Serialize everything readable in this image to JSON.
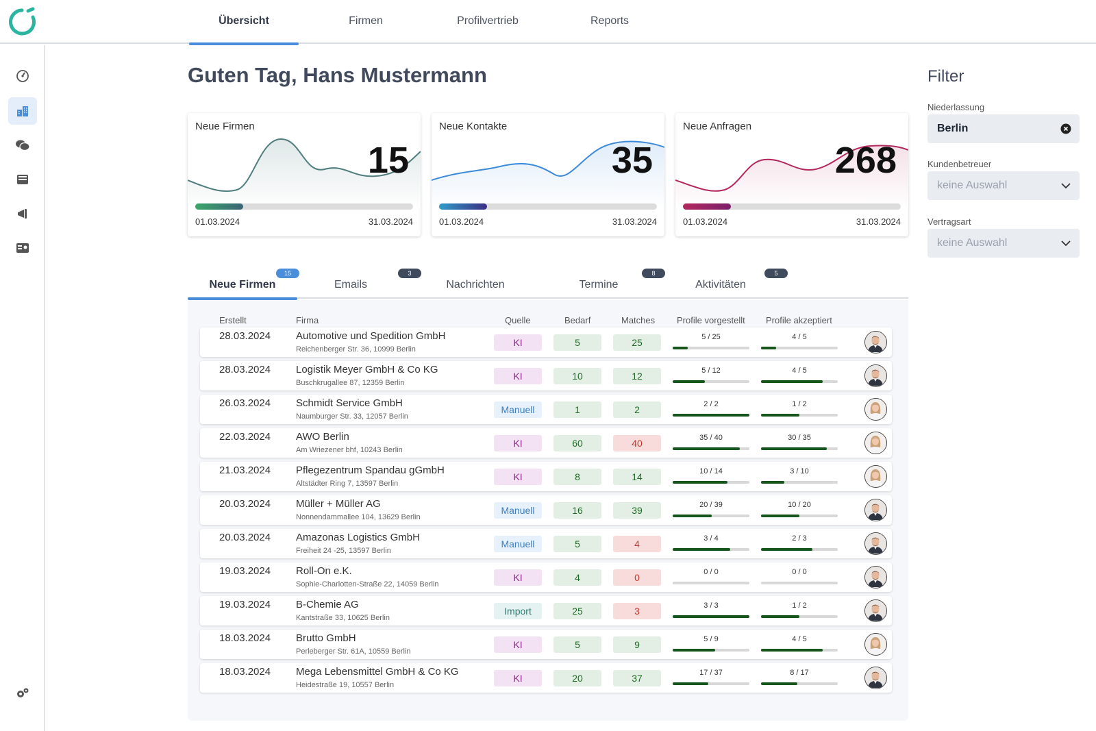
{
  "nav": {
    "tabs": [
      {
        "label": "Übersicht",
        "active": true
      },
      {
        "label": "Firmen",
        "active": false
      },
      {
        "label": "Profilvertrieb",
        "active": false
      },
      {
        "label": "Reports",
        "active": false
      }
    ]
  },
  "sidebar": {
    "icons": [
      "dashboard-gauge-icon",
      "buildings-icon",
      "chat-bubbles-icon",
      "inbox-tray-icon",
      "megaphone-icon",
      "id-card-icon",
      "settings-gears-icon"
    ],
    "active": "buildings-icon"
  },
  "greeting": "Guten Tag, Hans Mustermann",
  "stats": [
    {
      "title": "Neue Firmen",
      "value": "15",
      "start": "01.03.2024",
      "end": "31.03.2024",
      "progress": 0.22,
      "color": "#4f7d7e",
      "gradient": [
        "#3aa86a",
        "#3b6476"
      ]
    },
    {
      "title": "Neue Kontakte",
      "value": "35",
      "start": "01.03.2024",
      "end": "31.03.2024",
      "progress": 0.22,
      "color": "#3b8ad9",
      "gradient": [
        "#2f9bc9",
        "#3b2f85"
      ]
    },
    {
      "title": "Neue Anfragen",
      "value": "268",
      "start": "01.03.2024",
      "end": "31.03.2024",
      "progress": 0.22,
      "color": "#b3275d",
      "gradient": [
        "#b3275d",
        "#7a1f6a"
      ]
    }
  ],
  "tabs": [
    {
      "label": "Neue Firmen",
      "badge": "15",
      "badge_color": "#4a8ddb",
      "active": true
    },
    {
      "label": "Emails",
      "badge": "3",
      "badge_color": "#3f4a5c",
      "active": false
    },
    {
      "label": "Nachrichten",
      "badge": "",
      "active": false
    },
    {
      "label": "Termine",
      "badge": "8",
      "badge_color": "#3f4a5c",
      "active": false
    },
    {
      "label": "Aktivitäten",
      "badge": "5",
      "badge_color": "#3f4a5c",
      "active": false
    }
  ],
  "table": {
    "headers": [
      "Erstellt",
      "Firma",
      "Quelle",
      "Bedarf",
      "Matches",
      "Profile vorgestellt",
      "Profile akzeptiert"
    ],
    "rows": [
      {
        "date": "28.03.2024",
        "name": "Automotive und Spedition GmbH",
        "address": "Reichenberger Str. 36, 10999 Berlin",
        "source": "KI",
        "bedarf": "5",
        "matches": "25",
        "matches_alert": false,
        "vorgestellt": "5 / 25",
        "vorgestellt_ratio": 0.2,
        "akzeptiert": "4 / 5",
        "akzeptiert_ratio": 0.2,
        "avatar": "male"
      },
      {
        "date": "28.03.2024",
        "name": "Logistik Meyer GmbH & Co KG",
        "address": "Buschkrugallee 87, 12359 Berlin",
        "source": "KI",
        "bedarf": "10",
        "matches": "12",
        "matches_alert": false,
        "vorgestellt": "5 / 12",
        "vorgestellt_ratio": 0.42,
        "akzeptiert": "4 / 5",
        "akzeptiert_ratio": 0.8,
        "avatar": "male"
      },
      {
        "date": "26.03.2024",
        "name": "Schmidt Service GmbH",
        "address": "Naumburger Str. 33, 12057 Berlin",
        "source": "Manuell",
        "bedarf": "1",
        "matches": "2",
        "matches_alert": false,
        "vorgestellt": "2 / 2",
        "vorgestellt_ratio": 1.0,
        "akzeptiert": "1 / 2",
        "akzeptiert_ratio": 0.5,
        "avatar": "female"
      },
      {
        "date": "22.03.2024",
        "name": "AWO Berlin",
        "address": "Am Wriezener bhf, 10243 Berlin",
        "source": "KI",
        "bedarf": "60",
        "matches": "40",
        "matches_alert": true,
        "vorgestellt": "35 / 40",
        "vorgestellt_ratio": 0.875,
        "akzeptiert": "30 / 35",
        "akzeptiert_ratio": 0.857,
        "avatar": "female"
      },
      {
        "date": "21.03.2024",
        "name": "Pflegezentrum Spandau gGmbH",
        "address": "Altstädter Ring 7, 13597 Berlin",
        "source": "KI",
        "bedarf": "8",
        "matches": "14",
        "matches_alert": false,
        "vorgestellt": "10 / 14",
        "vorgestellt_ratio": 0.714,
        "akzeptiert": "3 / 10",
        "akzeptiert_ratio": 0.3,
        "avatar": "female"
      },
      {
        "date": "20.03.2024",
        "name": "Müller + Müller AG",
        "address": "Nonnendammallee 104, 13629 Berlin",
        "source": "Manuell",
        "bedarf": "16",
        "matches": "39",
        "matches_alert": false,
        "vorgestellt": "20 / 39",
        "vorgestellt_ratio": 0.51,
        "akzeptiert": "10 / 20",
        "akzeptiert_ratio": 0.5,
        "avatar": "male"
      },
      {
        "date": "20.03.2024",
        "name": "Amazonas Logistics GmbH",
        "address": "Freiheit 24 -25, 13597 Berlin",
        "source": "Manuell",
        "bedarf": "5",
        "matches": "4",
        "matches_alert": true,
        "vorgestellt": "3 / 4",
        "vorgestellt_ratio": 0.75,
        "akzeptiert": "2 / 3",
        "akzeptiert_ratio": 0.667,
        "avatar": "male"
      },
      {
        "date": "19.03.2024",
        "name": "Roll-On e.K.",
        "address": "Sophie-Charlotten-Straße 22, 14059 Berlin",
        "source": "KI",
        "bedarf": "4",
        "matches": "0",
        "matches_alert": true,
        "vorgestellt": "0 / 0",
        "vorgestellt_ratio": 0,
        "akzeptiert": "0 / 0",
        "akzeptiert_ratio": 0,
        "avatar": "male"
      },
      {
        "date": "19.03.2024",
        "name": "B-Chemie AG",
        "address": "Kantstraße 33, 10625 Berlin",
        "source": "Import",
        "bedarf": "25",
        "matches": "3",
        "matches_alert": true,
        "vorgestellt": "3 / 3",
        "vorgestellt_ratio": 1.0,
        "akzeptiert": "1 / 2",
        "akzeptiert_ratio": 0.5,
        "avatar": "male"
      },
      {
        "date": "18.03.2024",
        "name": "Brutto GmbH",
        "address": "Perleberger Str. 61A, 10559 Berlin",
        "source": "KI",
        "bedarf": "5",
        "matches": "9",
        "matches_alert": false,
        "vorgestellt": "5 / 9",
        "vorgestellt_ratio": 0.556,
        "akzeptiert": "4 / 5",
        "akzeptiert_ratio": 0.8,
        "avatar": "female"
      },
      {
        "date": "18.03.2024",
        "name": "Mega Lebensmittel GmbH & Co KG",
        "address": "Heidestraße 19, 10557 Berlin",
        "source": "KI",
        "bedarf": "20",
        "matches": "37",
        "matches_alert": false,
        "vorgestellt": "17 / 37",
        "vorgestellt_ratio": 0.46,
        "akzeptiert": "8 / 17",
        "akzeptiert_ratio": 0.47,
        "avatar": "male"
      }
    ]
  },
  "filter": {
    "title": "Filter",
    "niederlassung_label": "Niederlassung",
    "niederlassung_value": "Berlin",
    "kundenbetreuer_label": "Kundenbetreuer",
    "kundenbetreuer_value": "keine Auswahl",
    "vertragsart_label": "Vertragsart",
    "vertragsart_value": "keine Auswahl"
  }
}
